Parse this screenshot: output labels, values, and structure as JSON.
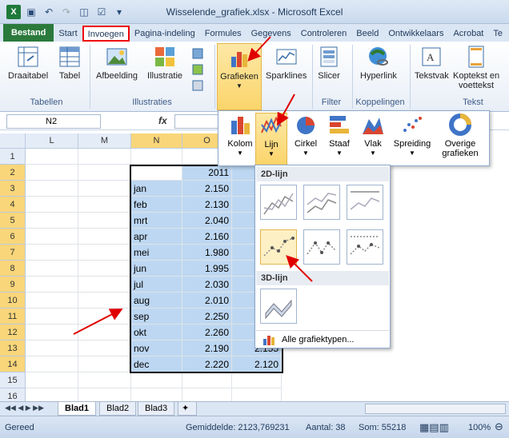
{
  "window": {
    "title": "Wisselende_grafiek.xlsx - Microsoft Excel"
  },
  "tabs": [
    "Bestand",
    "Start",
    "Invoegen",
    "Pagina-indeling",
    "Formules",
    "Gegevens",
    "Controleren",
    "Beeld",
    "Ontwikkelaars",
    "Acrobat",
    "Te"
  ],
  "ribbon": {
    "draaitabel": "Draaitabel",
    "tabel": "Tabel",
    "afbeelding": "Afbeelding",
    "illustratie": "Illustratie",
    "grafieken": "Grafieken",
    "sparklines": "Sparklines",
    "slicer": "Slicer",
    "hyperlink": "Hyperlink",
    "tekstvak": "Tekstvak",
    "koptekst_l1": "Koptekst en",
    "koptekst_l2": "voettekst",
    "groups": {
      "tabellen": "Tabellen",
      "illustraties": "Illustraties",
      "filter": "Filter",
      "koppelingen": "Koppelingen",
      "tekst": "Tekst"
    }
  },
  "formula_bar": {
    "name_box": "N2",
    "fx": "fx"
  },
  "columns": [
    "L",
    "M",
    "N",
    "O"
  ],
  "rows": [
    "1",
    "2",
    "3",
    "4",
    "5",
    "6",
    "7",
    "8",
    "9",
    "10",
    "11",
    "12",
    "13",
    "14",
    "15",
    "16"
  ],
  "table": {
    "header_year": "2011",
    "months": [
      "jan",
      "feb",
      "mrt",
      "apr",
      "mei",
      "jun",
      "jul",
      "aug",
      "sep",
      "okt",
      "nov",
      "dec"
    ],
    "values": [
      "2.150",
      "2.130",
      "2.040",
      "2.160",
      "1.980",
      "1.995",
      "2.030",
      "2.010",
      "2.250",
      "2.260",
      "2.190",
      "2.220"
    ],
    "col_p_partial": {
      "nov": "2.155",
      "dec": "2.120"
    }
  },
  "chart_gallery": {
    "items": [
      "Kolom",
      "Lijn",
      "Cirkel",
      "Staaf",
      "Vlak",
      "Spreiding",
      "Overige"
    ],
    "overige_line2": "grafieken",
    "section_2d": "2D-lijn",
    "section_3d": "3D-lijn",
    "all_types": "Alle grafiektypen..."
  },
  "sheets": [
    "Blad1",
    "Blad2",
    "Blad3"
  ],
  "status": {
    "mode": "Gereed",
    "average": "Gemiddelde: 2123,769231",
    "count": "Aantal: 38",
    "sum": "Som: 55218",
    "zoom": "100%"
  },
  "colors": {
    "file_tab": "#2b7a3c",
    "selection": "#bdd7f2",
    "highlight": "#fbd56b",
    "arrow": "#e00000"
  }
}
